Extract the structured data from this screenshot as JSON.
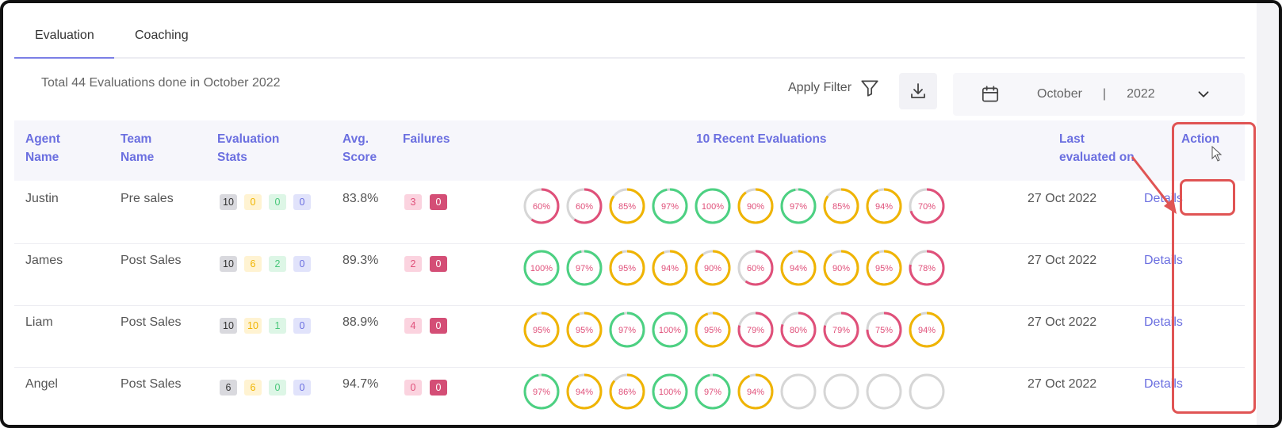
{
  "tabs": [
    {
      "label": "Evaluation",
      "active": true
    },
    {
      "label": "Coaching",
      "active": false
    }
  ],
  "filter_bar": {
    "summary": "Total 44 Evaluations done in October 2022",
    "apply_filter_label": "Apply Filter",
    "filter_icon": "filter-icon",
    "download_icon": "download-icon",
    "date": {
      "month": "October",
      "separator": "|",
      "year": "2022",
      "icon": "calendar-icon",
      "chevron": "chevron-down-icon"
    }
  },
  "table": {
    "headers": {
      "agent_name": "Agent\nName",
      "team_name": "Team\nName",
      "evaluation_stats": "Evaluation\nStats",
      "avg_score": "Avg.\nScore",
      "failures": "Failures",
      "recent": "10 Recent Evaluations",
      "last_evaluated": "Last\nevaluated on",
      "action": "Action"
    },
    "rows": [
      {
        "agent": "Justin",
        "team": "Pre sales",
        "stats": [
          "10",
          "0",
          "0",
          "0"
        ],
        "avg": "83.8%",
        "failures": [
          "3",
          "0"
        ],
        "recent": [
          {
            "label": "60%",
            "value": 60,
            "color": "#e0507a"
          },
          {
            "label": "60%",
            "value": 60,
            "color": "#e0507a"
          },
          {
            "label": "85%",
            "value": 85,
            "color": "#f0b400"
          },
          {
            "label": "97%",
            "value": 97,
            "color": "#4cd182"
          },
          {
            "label": "100%",
            "value": 100,
            "color": "#4cd182"
          },
          {
            "label": "90%",
            "value": 90,
            "color": "#f0b400"
          },
          {
            "label": "97%",
            "value": 97,
            "color": "#4cd182"
          },
          {
            "label": "85%",
            "value": 85,
            "color": "#f0b400"
          },
          {
            "label": "94%",
            "value": 94,
            "color": "#f0b400"
          },
          {
            "label": "70%",
            "value": 70,
            "color": "#e0507a"
          }
        ],
        "last": "27 Oct 2022",
        "action": "Details"
      },
      {
        "agent": "James",
        "team": "Post Sales",
        "stats": [
          "10",
          "6",
          "2",
          "0"
        ],
        "avg": "89.3%",
        "failures": [
          "2",
          "0"
        ],
        "recent": [
          {
            "label": "100%",
            "value": 100,
            "color": "#4cd182"
          },
          {
            "label": "97%",
            "value": 97,
            "color": "#4cd182"
          },
          {
            "label": "95%",
            "value": 95,
            "color": "#f0b400"
          },
          {
            "label": "94%",
            "value": 94,
            "color": "#f0b400"
          },
          {
            "label": "90%",
            "value": 90,
            "color": "#f0b400"
          },
          {
            "label": "60%",
            "value": 60,
            "color": "#e0507a"
          },
          {
            "label": "94%",
            "value": 94,
            "color": "#f0b400"
          },
          {
            "label": "90%",
            "value": 90,
            "color": "#f0b400"
          },
          {
            "label": "95%",
            "value": 95,
            "color": "#f0b400"
          },
          {
            "label": "78%",
            "value": 78,
            "color": "#e0507a"
          }
        ],
        "last": "27 Oct 2022",
        "action": "Details"
      },
      {
        "agent": "Liam",
        "team": "Post Sales",
        "stats": [
          "10",
          "10",
          "1",
          "0"
        ],
        "avg": "88.9%",
        "failures": [
          "4",
          "0"
        ],
        "recent": [
          {
            "label": "95%",
            "value": 95,
            "color": "#f0b400"
          },
          {
            "label": "95%",
            "value": 95,
            "color": "#f0b400"
          },
          {
            "label": "97%",
            "value": 97,
            "color": "#4cd182"
          },
          {
            "label": "100%",
            "value": 100,
            "color": "#4cd182"
          },
          {
            "label": "95%",
            "value": 95,
            "color": "#f0b400"
          },
          {
            "label": "79%",
            "value": 79,
            "color": "#e0507a"
          },
          {
            "label": "80%",
            "value": 80,
            "color": "#e0507a"
          },
          {
            "label": "79%",
            "value": 79,
            "color": "#e0507a"
          },
          {
            "label": "75%",
            "value": 75,
            "color": "#e0507a"
          },
          {
            "label": "94%",
            "value": 94,
            "color": "#f0b400"
          }
        ],
        "last": "27 Oct 2022",
        "action": "Details"
      },
      {
        "agent": "Angel",
        "team": "Post Sales",
        "stats": [
          "6",
          "6",
          "0",
          "0"
        ],
        "avg": "94.7%",
        "failures": [
          "0",
          "0"
        ],
        "recent": [
          {
            "label": "97%",
            "value": 97,
            "color": "#4cd182"
          },
          {
            "label": "94%",
            "value": 94,
            "color": "#f0b400"
          },
          {
            "label": "86%",
            "value": 86,
            "color": "#f0b400"
          },
          {
            "label": "100%",
            "value": 100,
            "color": "#4cd182"
          },
          {
            "label": "97%",
            "value": 97,
            "color": "#4cd182"
          },
          {
            "label": "94%",
            "value": 94,
            "color": "#f0b400"
          },
          {
            "label": "",
            "value": 0,
            "color": "#d6d6d6"
          },
          {
            "label": "",
            "value": 0,
            "color": "#d6d6d6"
          },
          {
            "label": "",
            "value": 0,
            "color": "#d6d6d6"
          },
          {
            "label": "",
            "value": 0,
            "color": "#d6d6d6"
          }
        ],
        "last": "27 Oct 2022",
        "action": "Details"
      }
    ]
  },
  "colors": {
    "accent": "#6b6fe0",
    "highlight": "#e05454",
    "track": "#d6d6d6"
  }
}
